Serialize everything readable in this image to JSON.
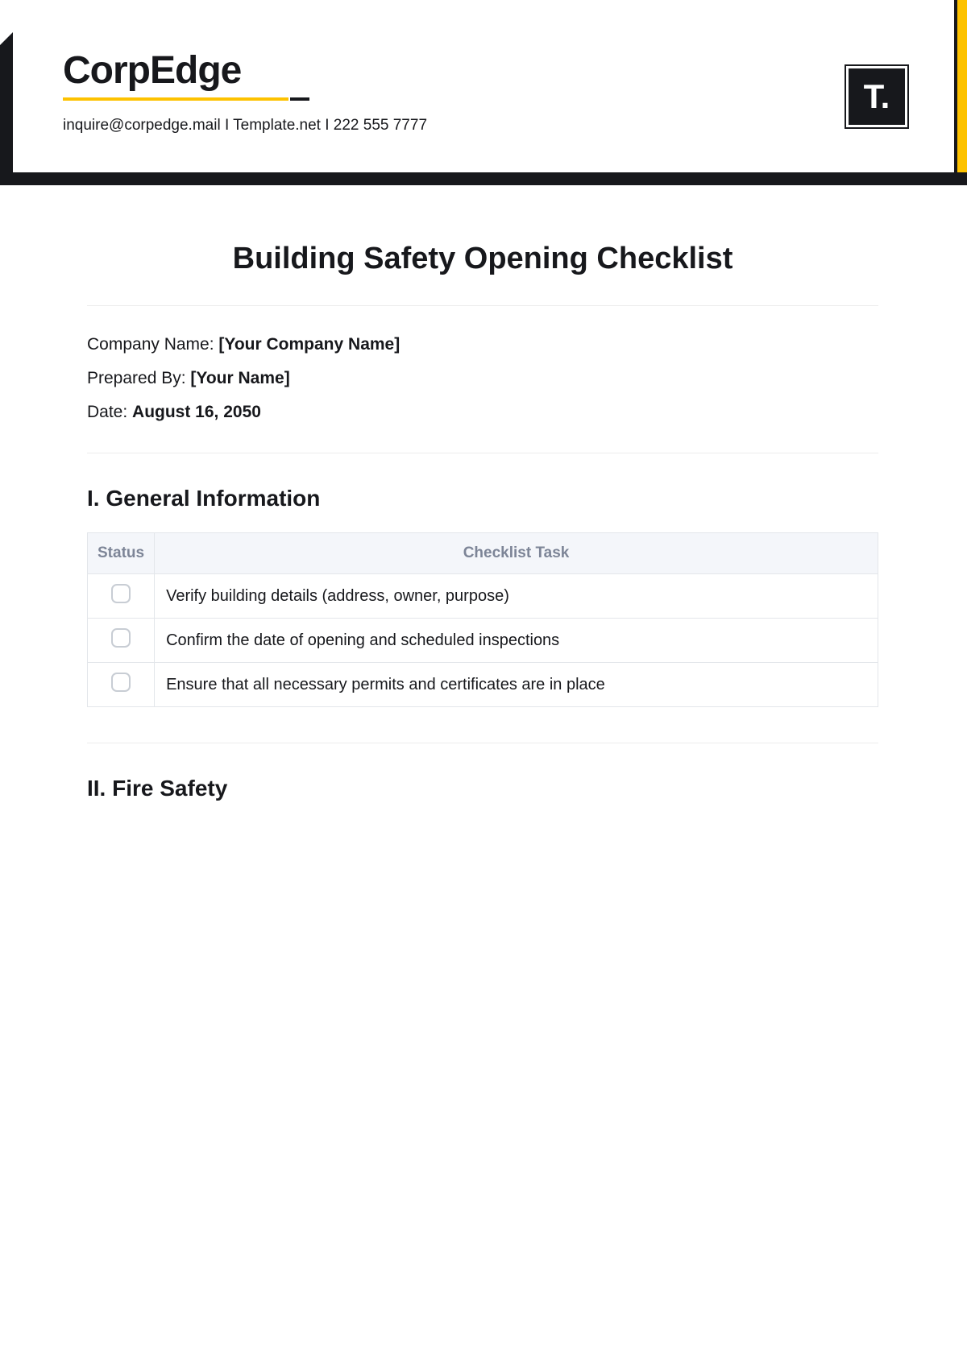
{
  "header": {
    "company": "CorpEdge",
    "contact": "inquire@corpedge.mail  I  Template.net  I  222 555 7777",
    "logo_text": "T."
  },
  "title": "Building Safety Opening Checklist",
  "meta": {
    "company_name_label": "Company Name: ",
    "company_name_value": "[Your Company Name]",
    "prepared_by_label": "Prepared By: ",
    "prepared_by_value": "[Your Name]",
    "date_label": "Date: ",
    "date_value": "August 16, 2050"
  },
  "sections": [
    {
      "heading": "I. General Information",
      "table": {
        "headers": {
          "status": "Status",
          "task": "Checklist Task"
        },
        "rows": [
          "Verify building details (address, owner, purpose)",
          "Confirm the date of opening and scheduled inspections",
          "Ensure that all necessary permits and certificates are in place"
        ]
      }
    },
    {
      "heading": "II. Fire Safety"
    }
  ]
}
